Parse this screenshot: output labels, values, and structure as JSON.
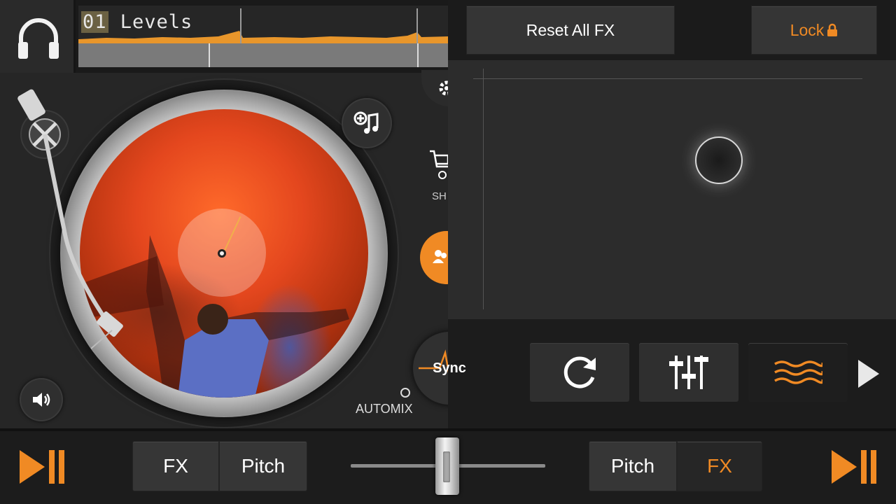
{
  "deck": {
    "track_title_number": "01",
    "track_title_name": " Levels"
  },
  "side": {
    "shop_label": "SH",
    "automix_label": "AUTOMIX",
    "sync_label": "Sync"
  },
  "fx_panel": {
    "reset_label": "Reset All FX",
    "lock_label": "Lock",
    "lock_icon": "🔒"
  },
  "bottom": {
    "left_fx": "FX",
    "left_pitch": "Pitch",
    "right_pitch": "Pitch",
    "right_fx": "FX",
    "crossfader_value": 0.5
  },
  "colors": {
    "accent": "#f08a24",
    "background": "#1c1c1c"
  },
  "icons": [
    "headphones-icon",
    "add-music-icon",
    "volume-icon",
    "settings-icon",
    "shop-cart-icon",
    "people-icon",
    "loop-icon",
    "equalizer-icon",
    "wave-fx-icon",
    "next-arrow-icon",
    "play-pause-icon"
  ]
}
